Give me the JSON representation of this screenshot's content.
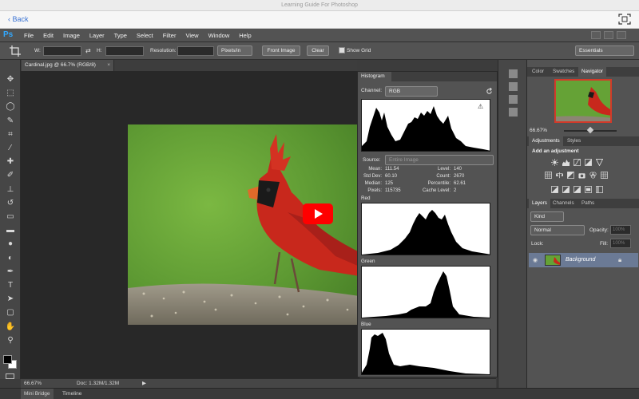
{
  "window": {
    "title": "Learning Guide For Photoshop"
  },
  "nav": {
    "back": "Back"
  },
  "app": {
    "logo": "Ps"
  },
  "menu": [
    "File",
    "Edit",
    "Image",
    "Layer",
    "Type",
    "Select",
    "Filter",
    "View",
    "Window",
    "Help"
  ],
  "options": {
    "w_label": "W:",
    "h_label": "H:",
    "resolution_label": "Resolution:",
    "units": "Pixels/in",
    "front_image": "Front Image",
    "clear": "Clear",
    "show_grid": "Show Grid",
    "workspace": "Essentials"
  },
  "document": {
    "tab": "Cardinal.jpg @ 66.7% (RGB/8)",
    "zoom": "66.67%",
    "doc_info": "Doc: 1.32M/1.32M"
  },
  "histogram": {
    "tab": "Histogram",
    "channel_label": "Channel:",
    "channel_value": "RGB",
    "source_label": "Source:",
    "source_value": "Entire Image",
    "stats": {
      "mean_label": "Mean:",
      "mean": "111.54",
      "std_label": "Std Dev:",
      "std": "60.10",
      "median_label": "Median:",
      "median": "125",
      "pixels_label": "Pixels:",
      "pixels": "115735",
      "level_label": "Level:",
      "level": "140",
      "count_label": "Count:",
      "count": "2670",
      "percentile_label": "Percentile:",
      "percentile": "62.61",
      "cache_label": "Cache Level:",
      "cache": "2"
    },
    "channels": [
      "Red",
      "Green",
      "Blue"
    ]
  },
  "panels": {
    "top_tabs": [
      "Color",
      "Swatches",
      "Navigator"
    ],
    "nav_zoom": "66.67%",
    "adj_tabs": [
      "Adjustments",
      "Styles"
    ],
    "add_adjustment": "Add an adjustment",
    "layer_tabs": [
      "Layers",
      "Channels",
      "Paths"
    ],
    "kind": "Kind",
    "blend_mode": "Normal",
    "opacity_label": "Opacity:",
    "opacity": "100%",
    "lock_label": "Lock:",
    "fill_label": "Fill:",
    "fill": "100%",
    "layer_name": "Background"
  },
  "bottom_tabs": [
    "Mini Bridge",
    "Timeline"
  ],
  "colors": {
    "accent": "#31a8ff",
    "play": "#ff0000",
    "selected_layer": "#6b7a95"
  }
}
